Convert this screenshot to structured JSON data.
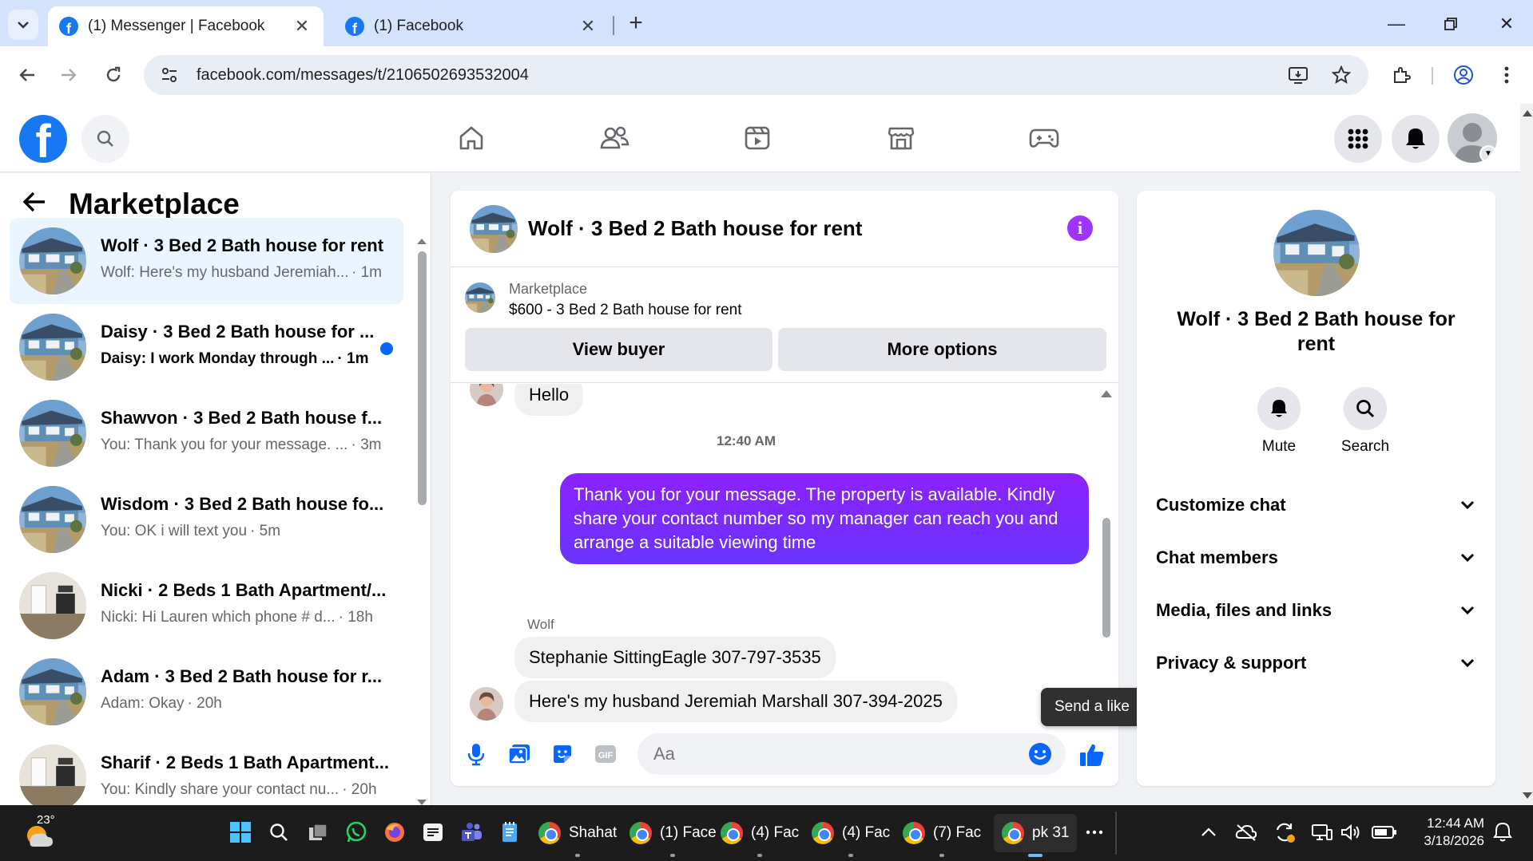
{
  "browser": {
    "tabs": [
      {
        "label": "(1) Messenger | Facebook",
        "active": true
      },
      {
        "label": "(1) Facebook",
        "active": false
      }
    ],
    "url": "facebook.com/messages/t/2106502693532004"
  },
  "left_panel": {
    "title": "Marketplace",
    "conversations": [
      {
        "title": "Wolf · 3 Bed 2 Bath house for rent",
        "snippet": "Wolf: Here's my husband Jeremiah...",
        "time": "· 1m",
        "selected": true,
        "unread": false
      },
      {
        "title": "Daisy · 3 Bed 2 Bath house for ...",
        "snippet": "Daisy: I work Monday through ...",
        "time": "· 1m",
        "selected": false,
        "unread": true
      },
      {
        "title": "Shawvon · 3 Bed 2 Bath house f...",
        "snippet": "You: Thank you for your message. ...",
        "time": "· 3m",
        "selected": false,
        "unread": false
      },
      {
        "title": "Wisdom · 3 Bed 2 Bath house fo...",
        "snippet": "You: OK i will text you",
        "time": "· 5m",
        "selected": false,
        "unread": false
      },
      {
        "title": "Nicki · 2 Beds 1 Bath Apartment/...",
        "snippet": "Nicki: Hi Lauren which phone # d...",
        "time": "· 18h",
        "selected": false,
        "unread": false
      },
      {
        "title": "Adam · 3 Bed 2 Bath house for r...",
        "snippet": "Adam: Okay",
        "time": "· 20h",
        "selected": false,
        "unread": false
      },
      {
        "title": "Sharif · 2 Beds 1 Bath Apartment...",
        "snippet": "You: Kindly share your contact nu...",
        "time": "· 20h",
        "selected": false,
        "unread": false
      }
    ]
  },
  "chat": {
    "title": "Wolf · 3 Bed 2 Bath house for rent",
    "listing": {
      "category": "Marketplace",
      "price_line": "$600 - 3 Bed 2 Bath house for rent",
      "view_buyer": "View buyer",
      "more_options": "More options"
    },
    "messages": {
      "hello": "Hello",
      "timestamp": "12:40 AM",
      "outgoing": "Thank you for your message. The property is available. Kindly share your contact number so my manager can reach you and arrange a suitable viewing time",
      "sender": "Wolf",
      "incoming_1": "Stephanie SittingEagle 307-797-3535",
      "incoming_2": "Here's my husband Jeremiah Marshall 307-394-2025"
    },
    "composer": {
      "placeholder": "Aa",
      "like_tooltip": "Send a like"
    }
  },
  "right_panel": {
    "title": "Wolf · 3 Bed 2 Bath house for rent",
    "mute": "Mute",
    "search": "Search",
    "sections": [
      "Customize chat",
      "Chat members",
      "Media, files and links",
      "Privacy & support"
    ]
  },
  "taskbar": {
    "temperature": "23°",
    "apps": [
      "Shahat",
      "(1) Face",
      "(4) Fac",
      "(4) Fac",
      "(7) Fac",
      "pk 31"
    ],
    "time": "12:44 AM",
    "date": "3/18/2026"
  },
  "colors": {
    "fb_blue": "#1877f2",
    "messenger_purple": "#8c21ff",
    "unread_dot": "#0866ff",
    "info_icon": "#a033ff"
  }
}
